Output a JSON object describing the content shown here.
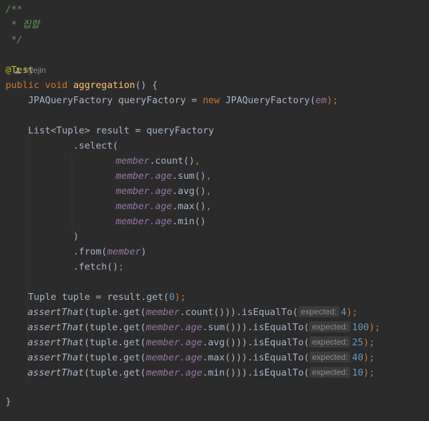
{
  "javadoc": {
    "open": "/**",
    "body": " * 집합",
    "close": " */"
  },
  "author": {
    "icon": "user-icon",
    "name": "hyejin"
  },
  "annotation": "@Test",
  "method": {
    "modifiers": "public void ",
    "name": "aggregation",
    "params": "() {"
  },
  "code": {
    "factory_type": "    JPAQueryFactory queryFactory = ",
    "kw_new": "new",
    "factory_ctor": " JPAQueryFactory(",
    "em": "em",
    "factory_end": ");",
    "list_decl": "    List<Tuple> result = queryFactory",
    "select": "            .select(",
    "member": "member",
    "count": ".count()",
    "dot_age": ".age",
    "sum": ".sum()",
    "avg": ".avg()",
    "max": ".max()",
    "min": ".min()",
    "comma": ",",
    "close_select": "            )",
    "from_open": "            .from(",
    "close_paren": ")",
    "fetch": "            .fetch()",
    "semicolon": ";",
    "tuple_decl": "    Tuple tuple = result.get(",
    "zero": "0",
    "tuple_end": ");",
    "assert_that": "assertThat",
    "tuple_get": "(tuple.get(",
    "count_close": ".count())).isEqualTo(",
    "sum_close": ".sum())).isEqualTo(",
    "avg_close": ".avg())).isEqualTo(",
    "max_close": ".max())).isEqualTo(",
    "min_close": ".min())).isEqualTo(",
    "hint_expected": "expected:",
    "v_count": "4",
    "v_sum": "100",
    "v_avg": "25",
    "v_max": "40",
    "v_min": "10",
    "stmt_end": ");",
    "close_brace": "}"
  }
}
